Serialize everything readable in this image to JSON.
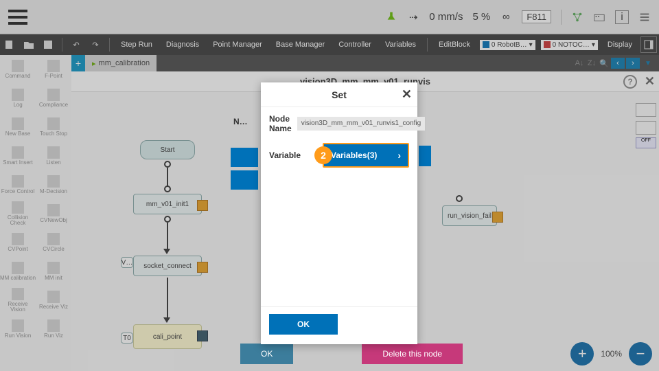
{
  "status": {
    "speed_value": "0 mm/s",
    "power_value": "5 %",
    "fcode": "F811"
  },
  "menu": {
    "step_run": "Step Run",
    "diagnosis": "Diagnosis",
    "point_manager": "Point Manager",
    "base_manager": "Base Manager",
    "controller": "Controller",
    "variables": "Variables",
    "edit_block": "EditBlock",
    "robot_sel": "0 RobotB…",
    "tool_sel": "0 NOTOC…",
    "display": "Display"
  },
  "toolbox": {
    "r1a": "Command",
    "r1b": "F-Point",
    "r2a": "Log",
    "r2b": "Compliance",
    "r3a": "New Base",
    "r3b": "Touch Stop",
    "r4a": "Smart Insert",
    "r4b": "Listen",
    "r5a": "Force Control",
    "r5b": "M-Decision",
    "r6a": "Collision Check",
    "r6b": "CVNewObj",
    "r7a": "CVPoint",
    "r7b": "CVCircle",
    "r8a": "MM calibration",
    "r8b": "MM init",
    "r9a": "Receive Vision",
    "r9b": "Receive Viz",
    "r10a": "Run Vision",
    "r10b": "Run Viz"
  },
  "tab": {
    "name": "mm_calibration"
  },
  "flow": {
    "title": "vision3D_mm_mm_v01_runvis",
    "n_start": "Start",
    "n_init": "mm_v01_init1",
    "n_sock": "socket_connect",
    "n_sock_v": "V…",
    "n_cali": "cali_point",
    "n_cali_t": "T0",
    "n_fail": "run_vision_fail"
  },
  "bottom": {
    "ok": "OK",
    "del": "Delete this node"
  },
  "dialog": {
    "title": "Set",
    "node_name_label": "Node Name",
    "node_name_value": "vision3D_mm_mm_v01_runvis1_config",
    "variable_label": "Variable",
    "variable_btn": "Variables(3)",
    "step": "2",
    "ok": "OK",
    "outer_label": "N…"
  },
  "zoom": {
    "pct": "100%"
  },
  "side": {
    "off": "OFF"
  }
}
